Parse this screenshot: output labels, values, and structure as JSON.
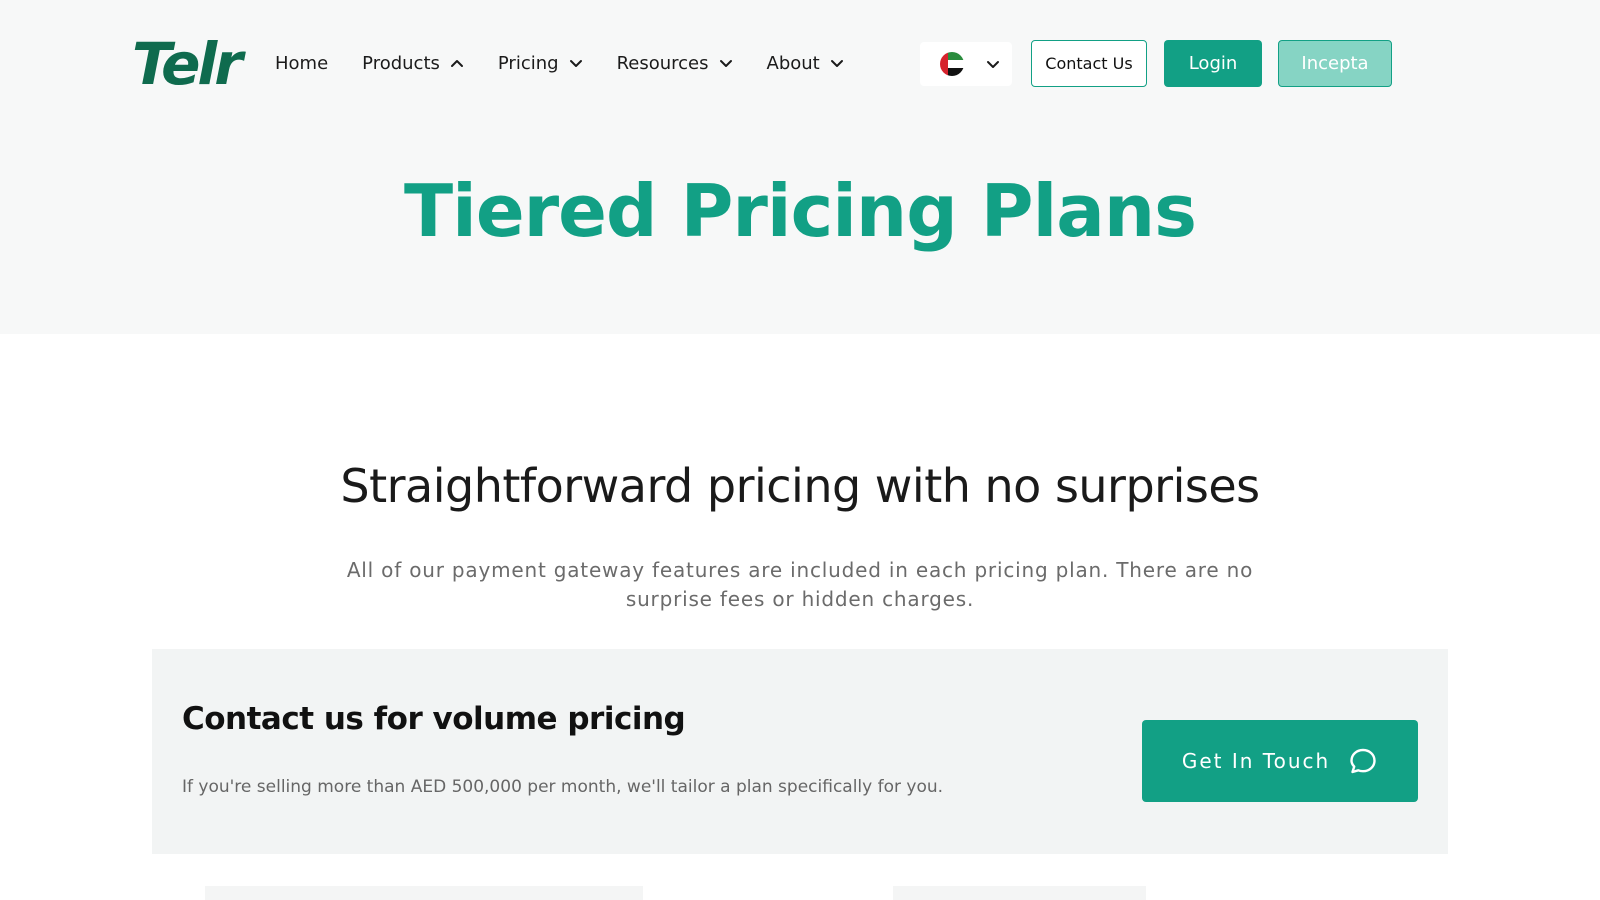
{
  "header": {
    "logo_text": "Telr",
    "nav": [
      {
        "label": "Home",
        "chevron": "none"
      },
      {
        "label": "Products",
        "chevron": "up"
      },
      {
        "label": "Pricing",
        "chevron": "down"
      },
      {
        "label": "Resources",
        "chevron": "down"
      },
      {
        "label": "About",
        "chevron": "down"
      }
    ],
    "language_selector": {
      "flag_icon": "uae-flag-icon"
    },
    "buttons": {
      "contact": "Contact Us",
      "login": "Login",
      "incepta": "Incepta"
    }
  },
  "hero": {
    "title": "Tiered Pricing Plans"
  },
  "main": {
    "headline": "Straightforward pricing with no surprises",
    "subtext": "All of our payment gateway features are included in each pricing plan. There are no surprise fees or hidden charges."
  },
  "volume_banner": {
    "title": "Contact us for volume pricing",
    "text": "If you're selling more than AED 500,000 per month, we'll tailor a plan specifically for you.",
    "button_label": "Get In Touch",
    "button_icon": "chat-bubble-icon"
  },
  "colors": {
    "brand_green": "#12a085",
    "logo_green": "#0f6b4e",
    "incepta_green": "#86d4c4",
    "hero_bg": "#f7f8f8",
    "banner_bg": "#f2f4f4"
  }
}
